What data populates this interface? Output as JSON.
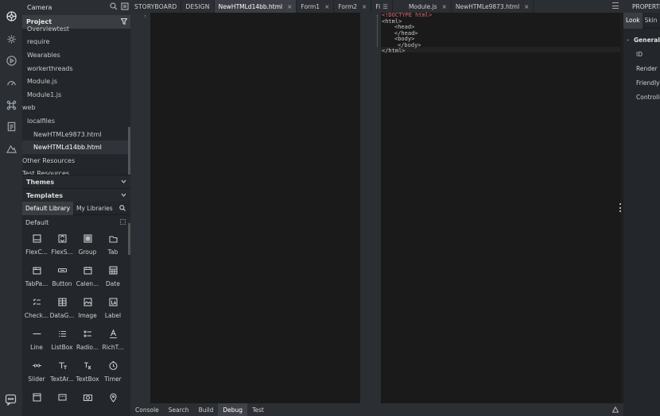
{
  "left_panel": {
    "top_title": "Camera",
    "project_header": "Project",
    "tree_items": [
      {
        "label": "Overviewtest",
        "indent": 6,
        "selected": false
      },
      {
        "label": "require",
        "indent": 6,
        "selected": false
      },
      {
        "label": "Wearables",
        "indent": 6,
        "selected": false
      },
      {
        "label": "workerthreads",
        "indent": 6,
        "selected": false
      },
      {
        "label": "Module.js",
        "indent": 6,
        "selected": false
      },
      {
        "label": "Module1.js",
        "indent": 6,
        "selected": false
      },
      {
        "label": "web",
        "indent": 0,
        "selected": false
      },
      {
        "label": "localfiles",
        "indent": 6,
        "selected": false
      },
      {
        "label": "NewHTMLe9873.html",
        "indent": 14,
        "selected": false
      },
      {
        "label": "NewHTMLd14bb.html",
        "indent": 14,
        "selected": true
      },
      {
        "label": "Other Resources",
        "indent": 0,
        "selected": false
      },
      {
        "label": "Test Resources",
        "indent": 0,
        "selected": false
      }
    ],
    "themes_header": "Themes",
    "templates_header": "Templates",
    "lib_tabs": [
      "Default Library",
      "My Libraries"
    ],
    "default_group": "Default",
    "components": [
      {
        "label": "FlexC...",
        "icon": "flex-container-icon"
      },
      {
        "label": "FlexS...",
        "icon": "flex-scroll-icon"
      },
      {
        "label": "Group",
        "icon": "group-icon"
      },
      {
        "label": "Tab",
        "icon": "tab-icon"
      },
      {
        "label": "TabPa...",
        "icon": "tab-pane-icon"
      },
      {
        "label": "Button",
        "icon": "button-icon"
      },
      {
        "label": "Calen...",
        "icon": "calendar-icon"
      },
      {
        "label": "Date",
        "icon": "date-icon"
      },
      {
        "label": "Check...",
        "icon": "checkbox-icon"
      },
      {
        "label": "DataG...",
        "icon": "datagrid-icon"
      },
      {
        "label": "Image",
        "icon": "image-icon"
      },
      {
        "label": "Label",
        "icon": "label-icon"
      },
      {
        "label": "Line",
        "icon": "line-icon"
      },
      {
        "label": "ListBox",
        "icon": "listbox-icon"
      },
      {
        "label": "Radio...",
        "icon": "radio-icon"
      },
      {
        "label": "RichT...",
        "icon": "richtext-icon"
      },
      {
        "label": "Slider",
        "icon": "slider-icon"
      },
      {
        "label": "TextAr...",
        "icon": "textarea-icon"
      },
      {
        "label": "TextBox",
        "icon": "textbox-icon"
      },
      {
        "label": "Timer",
        "icon": "timer-icon"
      },
      {
        "label": "",
        "icon": "browser-icon"
      },
      {
        "label": "",
        "icon": "video-icon"
      },
      {
        "label": "",
        "icon": "camera-icon"
      },
      {
        "label": "",
        "icon": "map-icon"
      }
    ]
  },
  "tabs": [
    {
      "label": "STORYBOARD",
      "closable": false,
      "active": false,
      "caps": true
    },
    {
      "label": "DESIGN",
      "closable": false,
      "active": false,
      "caps": true
    },
    {
      "label": "NewHTMLd14bb.html",
      "closable": true,
      "active": true,
      "caps": false
    },
    {
      "label": "Form1",
      "closable": true,
      "active": false,
      "caps": false
    },
    {
      "label": "Form2",
      "closable": true,
      "active": false,
      "caps": false
    },
    {
      "label": "Fi",
      "closable": false,
      "active": false,
      "caps": false
    },
    {
      "label": "Module.js",
      "closable": true,
      "active": false,
      "caps": false
    },
    {
      "label": "NewHTMLe9873.html",
      "closable": true,
      "active": false,
      "caps": false
    }
  ],
  "code_lines": [
    {
      "text": "<!DOCTYPE html>",
      "tag": true,
      "indent": 0
    },
    {
      "text": "<html>",
      "tag": false,
      "indent": 0
    },
    {
      "text": "<head>",
      "tag": false,
      "indent": 4
    },
    {
      "text": "",
      "tag": false,
      "indent": 0
    },
    {
      "text": "</head>",
      "tag": false,
      "indent": 4
    },
    {
      "text": "<body>",
      "tag": false,
      "indent": 4
    },
    {
      "text": "",
      "tag": false,
      "indent": 0
    },
    {
      "text": "</body>",
      "tag": false,
      "indent": 5
    },
    {
      "text": "</html>",
      "tag": false,
      "indent": 0
    }
  ],
  "properties": {
    "header": "PROPERTIES",
    "tabs": [
      "Look",
      "Skin",
      "F"
    ],
    "section": "General",
    "rows": [
      "ID",
      "Render",
      "Friendly N",
      "Controlle"
    ]
  },
  "bottom_tabs": [
    {
      "label": "Console",
      "active": false
    },
    {
      "label": "Search",
      "active": false
    },
    {
      "label": "Build",
      "active": false
    },
    {
      "label": "Debug",
      "active": true
    },
    {
      "label": "Test",
      "active": false
    }
  ],
  "rail_icons": [
    "project-icon",
    "settings-icon",
    "play-icon",
    "dashboard-icon",
    "command-icon",
    "document-icon",
    "terrain-icon",
    "feedback-icon"
  ]
}
